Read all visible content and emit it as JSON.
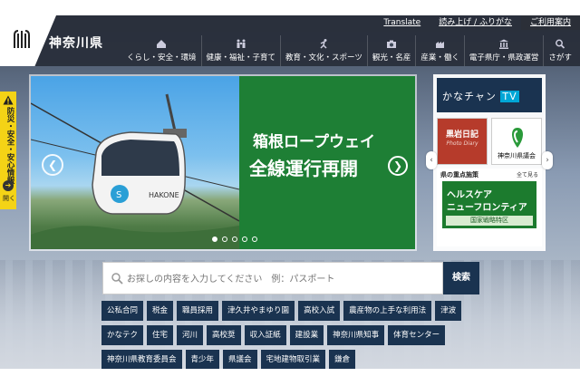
{
  "header": {
    "site_name": "神奈川県",
    "logo_alt": "KANAGAWA",
    "util_links": [
      "Translate",
      "読み上げ / ふりがな",
      "ご利用案内"
    ],
    "nav": [
      {
        "label": "くらし・安全・環境",
        "icon": "house-icon"
      },
      {
        "label": "健康・福祉・子育て",
        "icon": "family-icon"
      },
      {
        "label": "教育・文化・スポーツ",
        "icon": "runner-icon"
      },
      {
        "label": "観光・名産",
        "icon": "camera-icon"
      },
      {
        "label": "産業・働く",
        "icon": "factory-icon"
      },
      {
        "label": "電子県庁・県政運営",
        "icon": "building-icon"
      },
      {
        "label": "さがす",
        "icon": "search-icon"
      }
    ]
  },
  "side_tab": {
    "label": "防災・安全・安心情報",
    "open_label": "開く"
  },
  "hero": {
    "title": "箱根ロープウェイ",
    "subtitle": "全線運行再開",
    "gondola_text": "HAKONE",
    "dots": 5,
    "active_dot": 0
  },
  "right_panel": {
    "kanachan": "かなチャン",
    "kanachan_tv": "TV",
    "tile1_title": "黒岩日記",
    "tile1_sub": "Photo Diary",
    "tile2_title": "神奈川県議会",
    "section_head": "県の重点施策",
    "section_all": "全て見る",
    "banner_line1": "ヘルスケア",
    "banner_line2": "ニューフロンティア",
    "banner_line3": "国家戦略特区"
  },
  "search": {
    "placeholder": "お探しの内容を入力してください　例：パスポート",
    "button": "検索"
  },
  "tags": [
    [
      "公私合同",
      "税金",
      "職員採用",
      "津久井やまゆり園",
      "高校入試",
      "農産物の上手な利用法",
      "津波"
    ],
    [
      "かなテク",
      "住宅",
      "河川",
      "高校奨",
      "収入証紙",
      "建設業",
      "神奈川県知事",
      "体育センター"
    ],
    [
      "神奈川県教育委員会",
      "青少年",
      "県議会",
      "宅地建物取引業",
      "鎌倉"
    ]
  ],
  "colors": {
    "navy": "#1a3350",
    "green": "#1e7f35",
    "yellow": "#f4d316"
  }
}
